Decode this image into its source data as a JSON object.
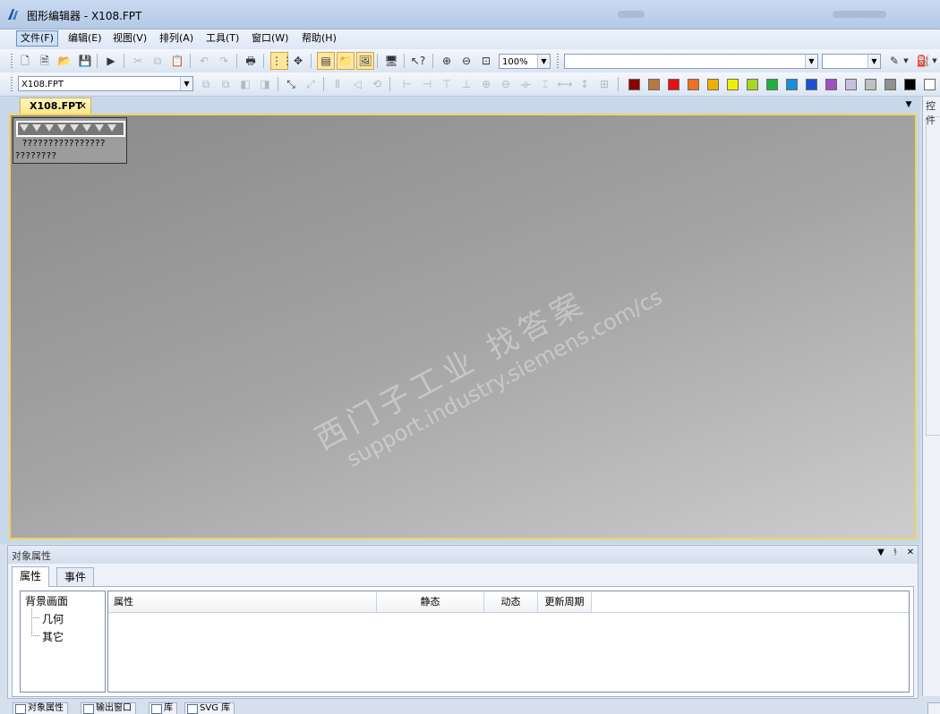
{
  "window": {
    "title": "图形编辑器 - X108.FPT"
  },
  "menu": {
    "items": [
      "文件(F)",
      "编辑(E)",
      "视图(V)",
      "排列(A)",
      "工具(T)",
      "窗口(W)",
      "帮助(H)"
    ]
  },
  "toolbar1": {
    "zoom_value": "100%"
  },
  "toolbar2": {
    "object_combo_value": "X108.FPT",
    "palette": [
      "#8b0000",
      "#b87840",
      "#e81010",
      "#f07020",
      "#f0b000",
      "#f0f000",
      "#a8d820",
      "#20b040",
      "#1890d8",
      "#2050d0",
      "#a050c0",
      "#c8c0e0",
      "#c0c0c0",
      "#909090",
      "#000000",
      "#ffffff"
    ]
  },
  "document": {
    "tab_label": "X108.FPT",
    "tab_close": "✕",
    "widget_text_1": "????????????????",
    "widget_text_2": "????????"
  },
  "watermark": {
    "line1": "西门子工业  找答案",
    "line2": "support.industry.siemens.com/cs"
  },
  "right_panel": {
    "title": "控件"
  },
  "properties_panel": {
    "title": "对象属性",
    "tabs": [
      "属性",
      "事件"
    ],
    "tree": {
      "root": "背景画面",
      "children": [
        "几何",
        "其它"
      ]
    },
    "columns": [
      "属性",
      "静态",
      "动态",
      "更新周期"
    ]
  },
  "bottom_tabs": [
    "对象属性",
    "输出窗口",
    "库",
    "SVG 库"
  ]
}
